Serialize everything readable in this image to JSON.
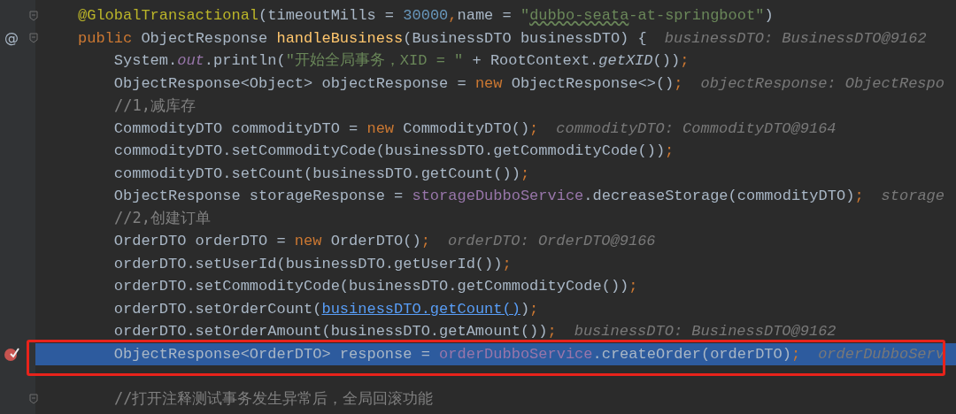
{
  "editor": {
    "lines": [
      {
        "kind": "code",
        "fold": true,
        "tokens": [
          {
            "kind": "annotation",
            "text": "@GlobalTransactional"
          },
          {
            "kind": "plain",
            "text": "(timeoutMills = "
          },
          {
            "kind": "number",
            "text": "30000"
          },
          {
            "kind": "keyword",
            "text": ","
          },
          {
            "kind": "plain",
            "text": "name = "
          },
          {
            "kind": "string",
            "text": "\""
          },
          {
            "kind": "typo",
            "text": "dubbo-seata"
          },
          {
            "kind": "string",
            "text": "-at-springboot\""
          },
          {
            "kind": "plain",
            "text": ")"
          }
        ]
      },
      {
        "kind": "code",
        "fold": true,
        "gutter_mark": "@",
        "tokens": [
          {
            "kind": "keyword",
            "text": "public "
          },
          {
            "kind": "plain",
            "text": "ObjectResponse "
          },
          {
            "kind": "method",
            "text": "handleBusiness"
          },
          {
            "kind": "plain",
            "text": "(BusinessDTO businessDTO) {"
          }
        ],
        "hint": "businessDTO: BusinessDTO@9162"
      },
      {
        "kind": "code",
        "tokens": [
          {
            "kind": "plain",
            "text": "    System."
          },
          {
            "kind": "static",
            "text": "out"
          },
          {
            "kind": "plain",
            "text": ".println("
          },
          {
            "kind": "string",
            "text": "\"开始全局事务，XID = \""
          },
          {
            "kind": "plain",
            "text": " + RootContext."
          },
          {
            "kind": "italic",
            "text": "getXID"
          },
          {
            "kind": "plain",
            "text": "())"
          },
          {
            "kind": "keyword",
            "text": ";"
          }
        ]
      },
      {
        "kind": "code",
        "tokens": [
          {
            "kind": "plain",
            "text": "    ObjectResponse<Object> objectResponse = "
          },
          {
            "kind": "keyword",
            "text": "new "
          },
          {
            "kind": "plain",
            "text": "ObjectResponse<>()"
          },
          {
            "kind": "keyword",
            "text": ";"
          }
        ],
        "hint": "objectResponse: ObjectRespo"
      },
      {
        "kind": "code",
        "tokens": [
          {
            "kind": "comment",
            "text": "    //1,减库存"
          }
        ]
      },
      {
        "kind": "code",
        "tokens": [
          {
            "kind": "plain",
            "text": "    CommodityDTO commodityDTO = "
          },
          {
            "kind": "keyword",
            "text": "new "
          },
          {
            "kind": "plain",
            "text": "CommodityDTO()"
          },
          {
            "kind": "keyword",
            "text": ";"
          }
        ],
        "hint": "commodityDTO: CommodityDTO@9164"
      },
      {
        "kind": "code",
        "tokens": [
          {
            "kind": "plain",
            "text": "    commodityDTO.setCommodityCode(businessDTO.getCommodityCode())"
          },
          {
            "kind": "keyword",
            "text": ";"
          }
        ]
      },
      {
        "kind": "code",
        "tokens": [
          {
            "kind": "plain",
            "text": "    commodityDTO.setCount(businessDTO.getCount())"
          },
          {
            "kind": "keyword",
            "text": ";"
          }
        ]
      },
      {
        "kind": "code",
        "tokens": [
          {
            "kind": "plain",
            "text": "    ObjectResponse storageResponse = "
          },
          {
            "kind": "field",
            "text": "storageDubboService"
          },
          {
            "kind": "plain",
            "text": ".decreaseStorage(commodityDTO)"
          },
          {
            "kind": "keyword",
            "text": ";"
          }
        ],
        "hint": "storage"
      },
      {
        "kind": "code",
        "tokens": [
          {
            "kind": "comment",
            "text": "    //2,创建订单"
          }
        ]
      },
      {
        "kind": "code",
        "tokens": [
          {
            "kind": "plain",
            "text": "    OrderDTO orderDTO = "
          },
          {
            "kind": "keyword",
            "text": "new "
          },
          {
            "kind": "plain",
            "text": "OrderDTO()"
          },
          {
            "kind": "keyword",
            "text": ";"
          }
        ],
        "hint": "orderDTO: OrderDTO@9166"
      },
      {
        "kind": "code",
        "tokens": [
          {
            "kind": "plain",
            "text": "    orderDTO.setUserId(businessDTO.getUserId())"
          },
          {
            "kind": "keyword",
            "text": ";"
          }
        ]
      },
      {
        "kind": "code",
        "tokens": [
          {
            "kind": "plain",
            "text": "    orderDTO.setCommodityCode(businessDTO.getCommodityCode())"
          },
          {
            "kind": "keyword",
            "text": ";"
          }
        ]
      },
      {
        "kind": "code",
        "tokens": [
          {
            "kind": "plain",
            "text": "    orderDTO.setOrderCount("
          },
          {
            "kind": "link",
            "text": "businessDTO.getCount()"
          },
          {
            "kind": "plain",
            "text": ")"
          },
          {
            "kind": "keyword",
            "text": ";"
          }
        ]
      },
      {
        "kind": "code",
        "tokens": [
          {
            "kind": "plain",
            "text": "    orderDTO.setOrderAmount(businessDTO.getAmount())"
          },
          {
            "kind": "keyword",
            "text": ";"
          }
        ],
        "hint": "businessDTO: BusinessDTO@9162"
      },
      {
        "kind": "code",
        "selected": true,
        "breakpoint": true,
        "boxed": true,
        "tokens": [
          {
            "kind": "plain",
            "text": "    ObjectResponse<OrderDTO> response = "
          },
          {
            "kind": "field",
            "text": "orderDubboService"
          },
          {
            "kind": "plain",
            "text": ".createOrder(orderDTO)"
          },
          {
            "kind": "keyword",
            "text": ";"
          }
        ],
        "hint": "orderDubboServ"
      },
      {
        "kind": "blank"
      },
      {
        "kind": "code",
        "fold": true,
        "tokens": [
          {
            "kind": "comment",
            "text": "    //打开注释测试事务发生异常后，全局回滚功能"
          }
        ]
      }
    ]
  }
}
